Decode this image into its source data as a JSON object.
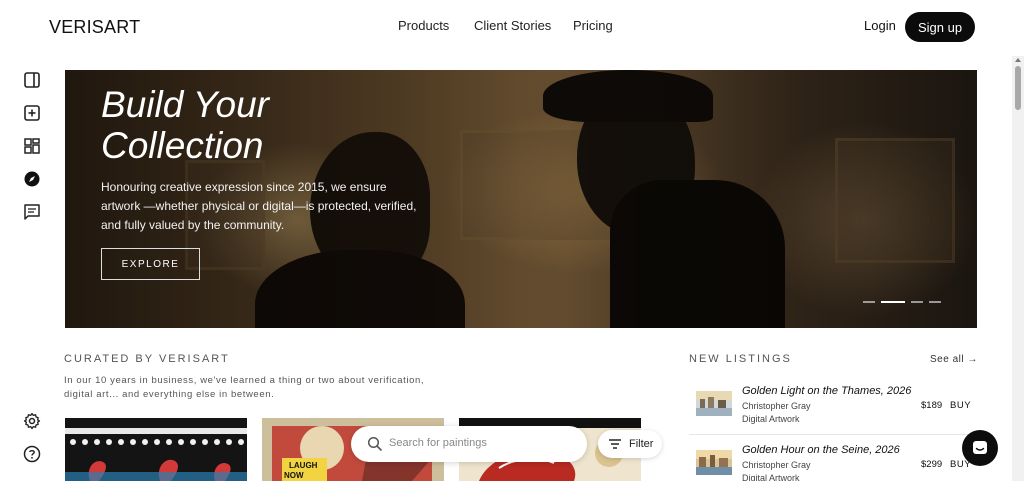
{
  "header": {
    "logo": "VERISART",
    "nav": [
      "Products",
      "Client Stories",
      "Pricing"
    ],
    "login": "Login",
    "signup": "Sign up"
  },
  "sidebar": {
    "icons": [
      "panel-toggle-icon",
      "add-square-icon",
      "dashboard-icon",
      "compass-icon",
      "message-icon"
    ],
    "bottom_icons": [
      "settings-icon",
      "help-icon"
    ]
  },
  "hero": {
    "title": "Build Your Collection",
    "text": "Honouring creative expression since 2015, we ensure artwork —whether physical or digital—is protected, verified, and fully valued by the community.",
    "cta": "EXPLORE",
    "slide_count": 4,
    "active_slide": 2
  },
  "curated": {
    "title": "CURATED BY VERISART",
    "description": "In our 10 years in business, we've learned a thing or two about verification, digital art... and everything else in between."
  },
  "search": {
    "placeholder": "Search for paintings",
    "filter_label": "Filter"
  },
  "new_listings": {
    "title": "NEW LISTINGS",
    "see_all": "See all →",
    "items": [
      {
        "title": "Golden Light on the Thames, 2026",
        "artist": "Christopher Gray",
        "type": "Digital Artwork",
        "price": "$189",
        "action": "BUY"
      },
      {
        "title": "Golden Hour on the Seine, 2026",
        "artist": "Christopher Gray",
        "type": "Digital Artwork",
        "price": "$299",
        "action": "BUY"
      }
    ]
  },
  "colors": {
    "primary": "#0b0b0b",
    "background": "#ffffff",
    "muted_text": "#555555"
  }
}
